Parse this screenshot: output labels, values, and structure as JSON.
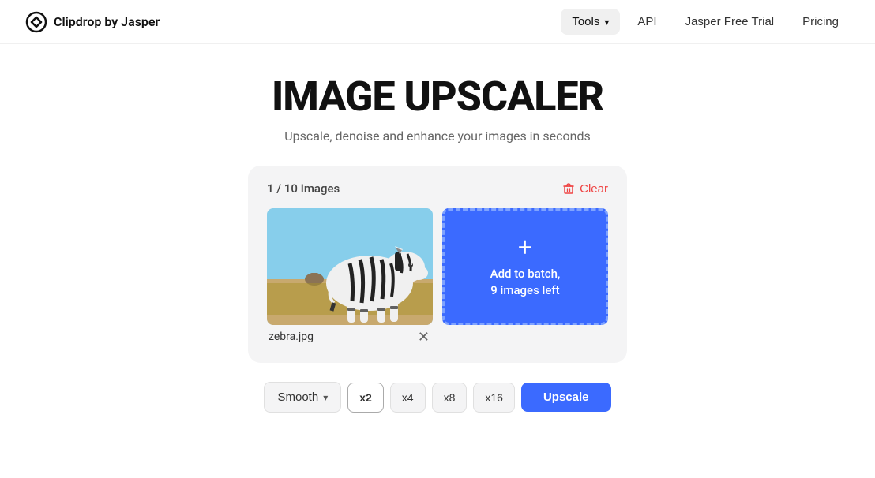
{
  "nav": {
    "logo_text": "Clipdrop by Jasper",
    "tools_label": "Tools",
    "api_label": "API",
    "trial_label": "Jasper Free Trial",
    "pricing_label": "Pricing"
  },
  "hero": {
    "title": "IMAGE UPSCALER",
    "subtitle": "Upscale, denoise and enhance your images in seconds"
  },
  "upload": {
    "count_label": "1 / 10 Images",
    "clear_label": "Clear",
    "image_filename": "zebra.jpg",
    "add_batch_plus": "+",
    "add_batch_line1": "Add to batch,",
    "add_batch_line2": "9 images left"
  },
  "toolbar": {
    "smooth_label": "Smooth",
    "scale_options": [
      "x2",
      "x4",
      "x8",
      "x16"
    ],
    "active_scale": "x2",
    "upscale_label": "Upscale"
  }
}
